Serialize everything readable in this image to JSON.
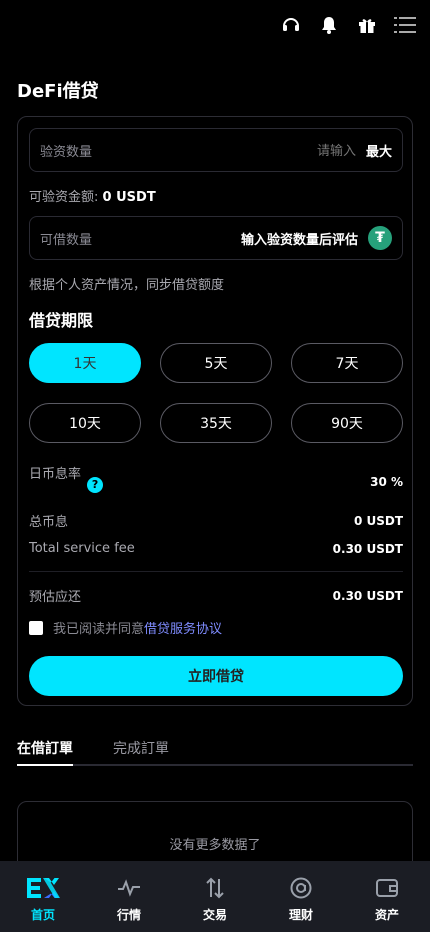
{
  "header": {
    "icons": [
      "headset-icon",
      "bell-icon",
      "gift-icon",
      "menu-icon"
    ]
  },
  "page": {
    "title": "DeFi借贷"
  },
  "form": {
    "collateral_label": "验资数量",
    "collateral_placeholder": "请输入",
    "max_label": "最大",
    "available_collateral_label": "可验资金额:",
    "available_collateral_value": "0 USDT",
    "borrowable_label": "可借数量",
    "borrowable_hint": "输入验资数量后评估",
    "note": "根据个人资产情况，同步借贷额度"
  },
  "term": {
    "title": "借贷期限",
    "options": [
      "1天",
      "5天",
      "7天",
      "10天",
      "35天",
      "90天"
    ],
    "selected": "1天"
  },
  "rates": {
    "daily_rate_label": "日币息率",
    "daily_rate_value": "30 %",
    "total_interest_label": "总币息",
    "total_interest_value": "0 USDT",
    "service_fee_label": "Total service fee",
    "service_fee_value": "0.30 USDT",
    "estimated_repay_label": "预估应还",
    "estimated_repay_value": "0.30 USDT"
  },
  "agreement": {
    "prefix": "我已阅读并同意",
    "link": "借贷服务协议",
    "checked": false
  },
  "action": {
    "borrow_now": "立即借贷"
  },
  "orders": {
    "tabs": [
      "在借訂單",
      "完成訂單"
    ],
    "active_tab": "在借訂單",
    "empty_text": "没有更多数据了"
  },
  "nav": {
    "items": [
      {
        "label": "首页",
        "icon": "logo-ex-icon",
        "active": true
      },
      {
        "label": "行情",
        "icon": "pulse-icon",
        "active": false
      },
      {
        "label": "交易",
        "icon": "swap-arrows-icon",
        "active": false
      },
      {
        "label": "理财",
        "icon": "at-circle-icon",
        "active": false
      },
      {
        "label": "资产",
        "icon": "wallet-icon",
        "active": false
      }
    ]
  },
  "colors": {
    "accent": "#00e5ff",
    "background": "#000000",
    "nav_bg": "#1b1d24",
    "link": "#7f8cff",
    "tether": "#26a17b"
  }
}
